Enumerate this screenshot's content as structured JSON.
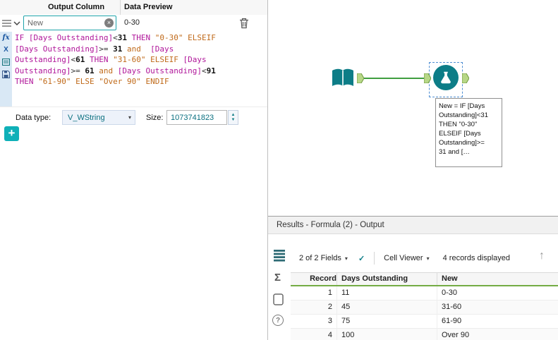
{
  "colors": {
    "accent_teal": "#0d7d87",
    "button_teal": "#0fb0b8",
    "connection_green": "#3f9e3f",
    "table_header_green": "#74ac44",
    "syntax_magenta": "#b0169a",
    "syntax_orange": "#c06a1a",
    "selection_blue": "#4f8fd3"
  },
  "icons": {
    "clear": "×",
    "caret": "▾",
    "check": "✓",
    "up_arrow": "↑",
    "question": "?",
    "sigma": "Σ",
    "plus": "+",
    "fx": "fx",
    "x_var": "X",
    "spin_up": "▲",
    "spin_down": "▼"
  },
  "config_panel": {
    "header": {
      "output_column": "Output Column",
      "data_preview": "Data Preview"
    },
    "expression_row": {
      "name": "New",
      "preview": "0-30"
    },
    "formula": {
      "lines": [
        [
          {
            "t": "IF ",
            "c": "k"
          },
          {
            "t": "[Days Outstanding]",
            "c": "f"
          },
          {
            "t": "<",
            "c": "p"
          },
          {
            "t": "31",
            "c": "n"
          },
          {
            "t": " THEN ",
            "c": "k"
          },
          {
            "t": "\"0-30\"",
            "c": "s"
          },
          {
            "t": " ELSEIF",
            "c": "o"
          }
        ],
        [
          {
            "t": "[Days Outstanding]",
            "c": "f"
          },
          {
            "t": ">= ",
            "c": "p"
          },
          {
            "t": "31",
            "c": "n"
          },
          {
            "t": " and",
            "c": "o"
          },
          {
            "t": "  ",
            "c": "p"
          },
          {
            "t": "[Days",
            "c": "f"
          }
        ],
        [
          {
            "t": "Outstanding]",
            "c": "f"
          },
          {
            "t": "<",
            "c": "p"
          },
          {
            "t": "61",
            "c": "n"
          },
          {
            "t": " THEN ",
            "c": "k"
          },
          {
            "t": "\"31-60\"",
            "c": "s"
          },
          {
            "t": " ELSEIF ",
            "c": "o"
          },
          {
            "t": "[Days",
            "c": "f"
          }
        ],
        [
          {
            "t": "Outstanding]",
            "c": "f"
          },
          {
            "t": ">= ",
            "c": "p"
          },
          {
            "t": "61",
            "c": "n"
          },
          {
            "t": " and ",
            "c": "o"
          },
          {
            "t": "[Days Outstanding]",
            "c": "f"
          },
          {
            "t": "<",
            "c": "p"
          },
          {
            "t": "91",
            "c": "n"
          }
        ],
        [
          {
            "t": "THEN ",
            "c": "k"
          },
          {
            "t": "\"61-90\"",
            "c": "s"
          },
          {
            "t": " ELSE ",
            "c": "o"
          },
          {
            "t": "\"Over 90\"",
            "c": "s"
          },
          {
            "t": " ENDIF",
            "c": "o"
          }
        ]
      ]
    },
    "data_type_label": "Data type:",
    "data_type_value": "V_WString",
    "size_label": "Size:",
    "size_value": "1073741823"
  },
  "canvas": {
    "annotation": "New = IF [Days\nOutstanding]<31\nTHEN \"0-30\"\nELSEIF [Days\nOutstanding]>=\n31 and  […"
  },
  "results": {
    "title": "Results - Formula (2) - Output",
    "toolbar": {
      "fields": "2 of 2 Fields",
      "cell_viewer": "Cell Viewer",
      "records": "4 records displayed"
    },
    "table": {
      "columns": [
        "Record",
        "Days Outstanding",
        "New"
      ],
      "rows": [
        [
          "1",
          "11",
          "0-30"
        ],
        [
          "2",
          "45",
          "31-60"
        ],
        [
          "3",
          "75",
          "61-90"
        ],
        [
          "4",
          "100",
          "Over 90"
        ]
      ]
    }
  }
}
